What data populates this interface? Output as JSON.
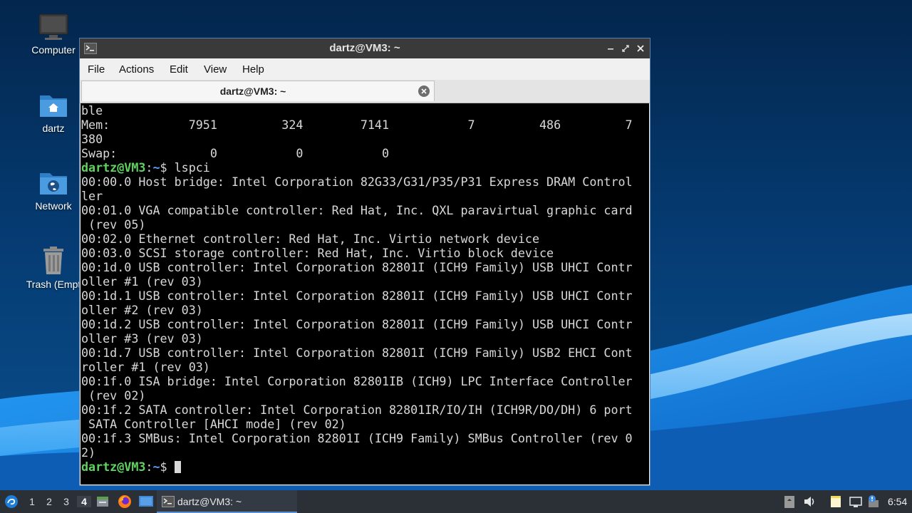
{
  "desktop": {
    "icons": [
      {
        "label": "Computer",
        "icon": "monitor-icon"
      },
      {
        "label": "dartz",
        "icon": "home-folder-icon"
      },
      {
        "label": "Network",
        "icon": "network-folder-icon"
      },
      {
        "label": "Trash (Empt",
        "icon": "trash-icon"
      }
    ]
  },
  "window": {
    "title": "dartz@VM3: ~",
    "menu": [
      "File",
      "Actions",
      "Edit",
      "View",
      "Help"
    ],
    "tab_label": "dartz@VM3: ~"
  },
  "terminal": {
    "prompt_user": "dartz@VM3",
    "prompt_dir": "~",
    "prompt_symbol": "$",
    "lines": [
      "ble",
      "Mem:           7951         324        7141           7         486         7",
      "380",
      "Swap:             0           0           0",
      "",
      "00:00.0 Host bridge: Intel Corporation 82G33/G31/P35/P31 Express DRAM Control",
      "ler",
      "00:01.0 VGA compatible controller: Red Hat, Inc. QXL paravirtual graphic card",
      " (rev 05)",
      "00:02.0 Ethernet controller: Red Hat, Inc. Virtio network device",
      "00:03.0 SCSI storage controller: Red Hat, Inc. Virtio block device",
      "00:1d.0 USB controller: Intel Corporation 82801I (ICH9 Family) USB UHCI Contr",
      "oller #1 (rev 03)",
      "00:1d.1 USB controller: Intel Corporation 82801I (ICH9 Family) USB UHCI Contr",
      "oller #2 (rev 03)",
      "00:1d.2 USB controller: Intel Corporation 82801I (ICH9 Family) USB UHCI Contr",
      "oller #3 (rev 03)",
      "00:1d.7 USB controller: Intel Corporation 82801I (ICH9 Family) USB2 EHCI Cont",
      "roller #1 (rev 03)",
      "00:1f.0 ISA bridge: Intel Corporation 82801IB (ICH9) LPC Interface Controller",
      " (rev 02)",
      "00:1f.2 SATA controller: Intel Corporation 82801IR/IO/IH (ICH9R/DO/DH) 6 port",
      " SATA Controller [AHCI mode] (rev 02)",
      "00:1f.3 SMBus: Intel Corporation 82801I (ICH9 Family) SMBus Controller (rev 0",
      "2)"
    ],
    "command": " lspci"
  },
  "taskbar": {
    "workspaces": [
      "1",
      "2",
      "3",
      "4"
    ],
    "active_workspace": "4",
    "task_label": "dartz@VM3: ~",
    "clock": "6:54"
  },
  "colors": {
    "prompt_user": "#5fd35f",
    "prompt_dir": "#5aa0ff",
    "desktop_bg": "#053a70",
    "accent_wave": "#1a8fe6"
  }
}
